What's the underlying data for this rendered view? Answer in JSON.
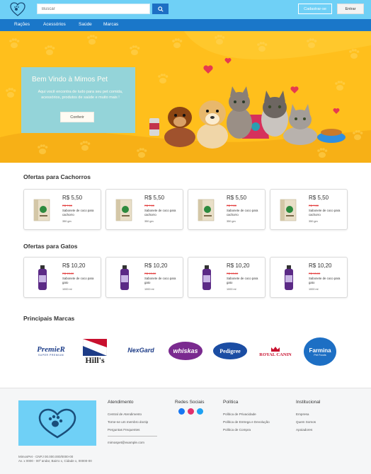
{
  "header": {
    "search": {
      "placeholder": "Buscar"
    },
    "register_label": "Cadastrar-se",
    "login_label": "Entrar"
  },
  "nav": {
    "items": [
      "Rações",
      "Acessórios",
      "Saúde",
      "Marcas"
    ]
  },
  "hero": {
    "title": "Bem Vindo à Mimos Pet",
    "text": "Aqui você encontra de tudo para seu pet comida, acessórios, produtos de saúde e muito mais !",
    "button_label": "Conferir"
  },
  "dogs": {
    "title": "Ofertas para Cachorros",
    "products": [
      {
        "price": "R$ 5,50",
        "old_price": "R$ 7,50",
        "name": "Sabonete de coco para cachorro",
        "weight": "350 gm"
      },
      {
        "price": "R$ 5,50",
        "old_price": "R$ 7,50",
        "name": "Sabonete de coco para cachorro",
        "weight": "350 gm"
      },
      {
        "price": "R$ 5,50",
        "old_price": "R$ 7,50",
        "name": "Sabonete de coco para cachorro",
        "weight": "350 gm"
      },
      {
        "price": "R$ 5,50",
        "old_price": "R$ 7,50",
        "name": "Sabonete de coco para cachorro",
        "weight": "350 gm"
      }
    ]
  },
  "cats": {
    "title": "Ofertas para Gatos",
    "products": [
      {
        "price": "R$ 10,20",
        "old_price": "R$ 13,00",
        "name": "Sabonete de coco para gato",
        "weight": "1000 ml"
      },
      {
        "price": "R$ 10,20",
        "old_price": "R$ 13,00",
        "name": "Sabonete de coco para gato",
        "weight": "1000 ml"
      },
      {
        "price": "R$ 10,20",
        "old_price": "R$ 13,00",
        "name": "Sabonete de coco para gato",
        "weight": "1000 ml"
      },
      {
        "price": "R$ 10,20",
        "old_price": "R$ 13,00",
        "name": "Sabonete de coco para gato",
        "weight": "1000 ml"
      }
    ]
  },
  "brands": {
    "title": "Principais Marcas",
    "items": [
      {
        "name": "PremieR",
        "sub": "SUPER PREMIUM"
      },
      {
        "name": "Hill's"
      },
      {
        "name": "NexGard"
      },
      {
        "name": "whiskas"
      },
      {
        "name": "Pedigree"
      },
      {
        "name": "ROYAL CANIN"
      },
      {
        "name": "Farmina",
        "sub": "Pet Foods"
      }
    ]
  },
  "footer": {
    "atendimento": {
      "title": "Atendimento",
      "links": [
        "Central de Atendimento",
        "Torne-se um membro doctip",
        "Perguntas Frequentes"
      ],
      "email": "mimospet@example.com"
    },
    "social": {
      "title": "Redes Sociais"
    },
    "politica": {
      "title": "Política",
      "links": [
        "Política de Privacidade",
        "Política de Entrega e Devolução",
        "Política de Compra"
      ]
    },
    "institucional": {
      "title": "Institucional",
      "links": [
        "Empresa",
        "Quem Somos",
        "Apoiadores"
      ]
    },
    "legal_1": "MimosPet - CNPJ 00.000.000/0000-00",
    "legal_2": "Av. x 0000 - 00º andar, Bairro x, Cidade x, 00000-00"
  },
  "colors": {
    "topbar": "#6fd0f6",
    "navbar": "#1a77c9",
    "hero": "#ffbf1c",
    "old_price": "#e23b3b"
  }
}
